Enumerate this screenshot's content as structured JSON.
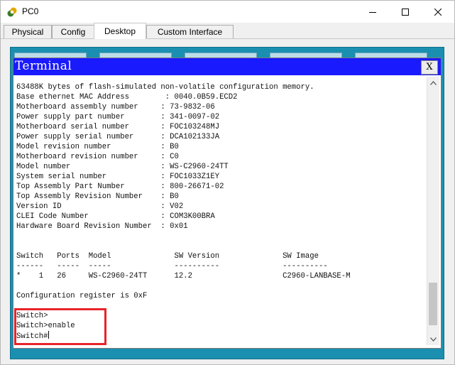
{
  "window": {
    "title": "PC0",
    "icon": "packet-tracer-pc-icon"
  },
  "tabs": [
    {
      "label": "Physical",
      "active": false
    },
    {
      "label": "Config",
      "active": false
    },
    {
      "label": "Desktop",
      "active": true
    },
    {
      "label": "Custom Interface",
      "active": false
    }
  ],
  "terminal": {
    "title": "Terminal",
    "close_label": "X",
    "lines": [
      "63488K bytes of flash-simulated non-volatile configuration memory.",
      "Base ethernet MAC Address        : 0040.0B59.ECD2",
      "Motherboard assembly number     : 73-9832-06",
      "Power supply part number        : 341-0097-02",
      "Motherboard serial number       : FOC103248MJ",
      "Power supply serial number      : DCA102133JA",
      "Model revision number           : B0",
      "Motherboard revision number     : C0",
      "Model number                    : WS-C2960-24TT",
      "System serial number            : FOC1033Z1EY",
      "Top Assembly Part Number        : 800-26671-02",
      "Top Assembly Revision Number    : B0",
      "Version ID                      : V02",
      "CLEI Code Number                : COM3K00BRA",
      "Hardware Board Revision Number  : 0x01",
      "",
      "",
      "Switch   Ports  Model              SW Version              SW Image",
      "------   -----  -----              ----------              ----------",
      "*    1   26     WS-C2960-24TT      12.2                    C2960-LANBASE-M",
      "",
      "Configuration register is 0xF",
      "",
      "Switch>",
      "Switch>enable",
      "Switch#"
    ]
  },
  "colors": {
    "terminal_header": "#1a1aff",
    "desktop_background": "#1b8fb0",
    "highlight_border": "#e8242a"
  }
}
